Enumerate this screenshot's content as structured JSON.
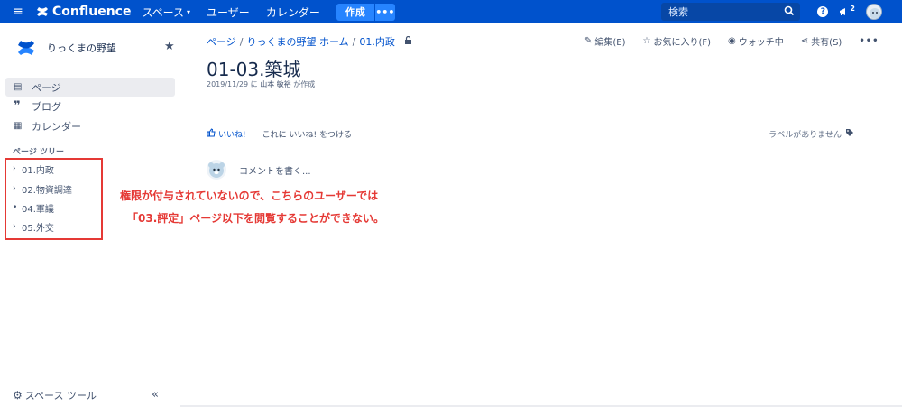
{
  "topbar": {
    "app_name": "Confluence",
    "nav": [
      "スペース",
      "ユーザー",
      "カレンダー"
    ],
    "create_label": "作成",
    "more_label": "•••",
    "search_placeholder": "検索",
    "help_label": "?",
    "notification_count": "2",
    "colors": {
      "bar": "#0052cc",
      "create": "#2684ff"
    }
  },
  "sidebar": {
    "space_name": "りっくまの野望",
    "links": [
      {
        "label": "ページ",
        "icon": "page-icon"
      },
      {
        "label": "ブログ",
        "icon": "quote-icon"
      },
      {
        "label": "カレンダー",
        "icon": "calendar-icon"
      }
    ],
    "tree_title": "ページ ツリー",
    "tree_items": [
      "01.内政",
      "02.物資調達",
      "04.軍議",
      "05.外交"
    ],
    "space_tools": "スペース ツール",
    "collapse": "«"
  },
  "main": {
    "breadcrumb": [
      "ページ",
      "りっくまの野望 ホーム",
      "01.内政"
    ],
    "actions": [
      {
        "label": "編集(E)",
        "icon": "pencil-icon"
      },
      {
        "label": "お気に入り(F)",
        "icon": "star-outline-icon"
      },
      {
        "label": "ウォッチ中",
        "icon": "eye-icon"
      },
      {
        "label": "共有(S)",
        "icon": "share-icon"
      }
    ],
    "more_actions": "•••",
    "title": "01-03.築城",
    "byline_date": "2019/11/29 に",
    "byline_author": "山本 敏裕",
    "byline_suffix": "が作成",
    "like_label": "いいね!",
    "like_prompt": "これに いいね! をつける",
    "no_labels": "ラベルがありません",
    "comment_placeholder": "コメントを書く..."
  },
  "annotation": {
    "line1": "権限が付与されていないので、こちらのユーザーでは",
    "line2": "「03.評定」ページ以下を閲覧することができない。",
    "color": "#e53935"
  }
}
